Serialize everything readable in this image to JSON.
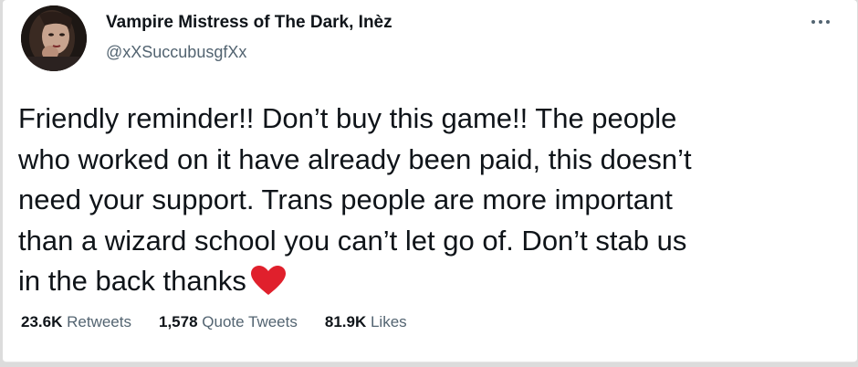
{
  "author": {
    "display_name": "Vampire Mistress of The Dark, Inèz",
    "handle": "@xXSuccubusgfXx"
  },
  "more_icon": "more-horizontal-icon",
  "tweet": {
    "text": "Friendly reminder!! Don’t buy this game!! The people\nwho worked on it have already been paid, this doesn’t\nneed your support. Trans people are more important\nthan a wizard school you can’t let go of. Don’t stab us\nin the back thanks",
    "emoji": "heart-emoji",
    "emoji_color": "#e0202c"
  },
  "stats": {
    "retweets": {
      "count": "23.6K",
      "label": "Retweets"
    },
    "quote_tweets": {
      "count": "1,578",
      "label": "Quote Tweets"
    },
    "likes": {
      "count": "81.9K",
      "label": "Likes"
    }
  },
  "colors": {
    "text_primary": "#0f1419",
    "text_secondary": "#536471",
    "background": "#ffffff"
  }
}
